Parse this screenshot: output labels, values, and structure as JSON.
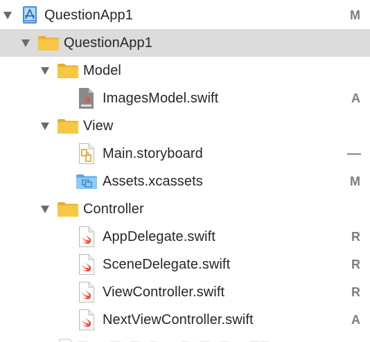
{
  "project": {
    "name": "QuestionApp1",
    "status": "M"
  },
  "group_main": {
    "name": "QuestionApp1"
  },
  "group_model": {
    "name": "Model"
  },
  "files": {
    "images_model": {
      "name": "ImagesModel.swift",
      "status": "A"
    },
    "main_storyboard": {
      "name": "Main.storyboard",
      "status": "—"
    },
    "assets": {
      "name": "Assets.xcassets",
      "status": "M"
    },
    "app_delegate": {
      "name": "AppDelegate.swift",
      "status": "R"
    },
    "scene_delegate": {
      "name": "SceneDelegate.swift",
      "status": "R"
    },
    "view_controller": {
      "name": "ViewController.swift",
      "status": "R"
    },
    "next_view_controller": {
      "name": "NextViewController.swift",
      "status": "A"
    }
  },
  "group_view": {
    "name": "View"
  },
  "group_controller": {
    "name": "Controller"
  },
  "colors": {
    "selection": "#dcdcdc",
    "folder": "#f5c33b",
    "swift_orange": "#f05138",
    "assets_blue": "#7cbfee",
    "status_gray": "#7d7d7d"
  },
  "icons": {
    "project": "xcode-project-icon",
    "folder": "folder-icon",
    "swift_file": "swift-file-icon",
    "storyboard": "storyboard-icon",
    "assets": "asset-catalog-icon",
    "disclosure": "disclosure-triangle-expanded-icon"
  }
}
